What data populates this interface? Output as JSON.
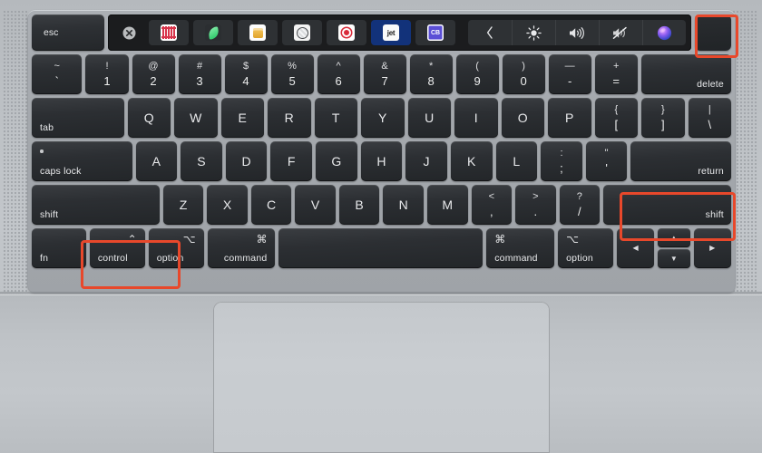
{
  "device": {
    "name": "MacBook Pro keyboard",
    "body_color": "#bcc0c4",
    "key_color": "#2c2f33",
    "highlight_color": "#e8482b"
  },
  "touch_bar": {
    "esc_label": "esc",
    "clear_icon": "circle-x-icon",
    "apps": [
      {
        "icon": "music-grid-app-icon",
        "active": false
      },
      {
        "icon": "green-leaf-app-icon",
        "active": false
      },
      {
        "icon": "yellow-box-app-icon",
        "active": false
      },
      {
        "icon": "gray-badge-app-icon",
        "active": false
      },
      {
        "icon": "red-record-app-icon",
        "active": false
      },
      {
        "icon": "jet-app-icon",
        "label": "jet",
        "active": true
      },
      {
        "icon": "cb-app-icon",
        "label": "CB",
        "active": false
      }
    ],
    "controls": [
      {
        "icon": "chevron-left-icon",
        "glyph": "‹"
      },
      {
        "icon": "brightness-icon",
        "glyph": "☀"
      },
      {
        "icon": "volume-up-icon",
        "glyph": "🔊"
      },
      {
        "icon": "volume-mute-icon",
        "glyph": "🔈"
      },
      {
        "icon": "siri-icon",
        "glyph": "●"
      }
    ],
    "touch_id": {
      "icon": "touch-id-power-icon",
      "highlighted": true
    }
  },
  "rows": {
    "numbers": [
      {
        "top": "~",
        "bot": "`"
      },
      {
        "top": "!",
        "bot": "1"
      },
      {
        "top": "@",
        "bot": "2"
      },
      {
        "top": "#",
        "bot": "3"
      },
      {
        "top": "$",
        "bot": "4"
      },
      {
        "top": "%",
        "bot": "5"
      },
      {
        "top": "^",
        "bot": "6"
      },
      {
        "top": "&",
        "bot": "7"
      },
      {
        "top": "*",
        "bot": "8"
      },
      {
        "top": "(",
        "bot": "9"
      },
      {
        "top": ")",
        "bot": "0"
      },
      {
        "top": "—",
        "bot": "-"
      },
      {
        "top": "+",
        "bot": "="
      }
    ],
    "delete_label": "delete",
    "tab_label": "tab",
    "qwerty": [
      "Q",
      "W",
      "E",
      "R",
      "T",
      "Y",
      "U",
      "I",
      "O",
      "P"
    ],
    "qwerty_punct": [
      {
        "top": "{",
        "bot": "["
      },
      {
        "top": "}",
        "bot": "]"
      },
      {
        "top": "|",
        "bot": "\\"
      }
    ],
    "caps_label": "caps lock",
    "home": [
      "A",
      "S",
      "D",
      "F",
      "G",
      "H",
      "J",
      "K",
      "L"
    ],
    "home_punct": [
      {
        "top": ":",
        "bot": ";"
      },
      {
        "top": "\"",
        "bot": "'"
      }
    ],
    "return_label": "return",
    "shift_left_label": "shift",
    "zxcv": [
      "Z",
      "X",
      "C",
      "V",
      "B",
      "N",
      "M"
    ],
    "zxcv_punct": [
      {
        "top": "<",
        "bot": ","
      },
      {
        "top": ">",
        "bot": "."
      },
      {
        "top": "?",
        "bot": "/"
      }
    ],
    "shift_right_label": "shift",
    "bottom": {
      "fn_label": "fn",
      "control_label": "control",
      "control_glyph": "⌃",
      "option_label": "option",
      "option_glyph": "⌥",
      "command_label": "command",
      "command_glyph": "⌘",
      "space_label": "",
      "arrow_left": "◀",
      "arrow_up": "▲",
      "arrow_down": "▼",
      "arrow_right": "▶"
    }
  },
  "highlights": [
    {
      "target": "touch-id-power-key"
    },
    {
      "target": "right-shift-key"
    },
    {
      "target": "control-and-option-keys"
    }
  ],
  "trackpad": {
    "name": "trackpad"
  }
}
